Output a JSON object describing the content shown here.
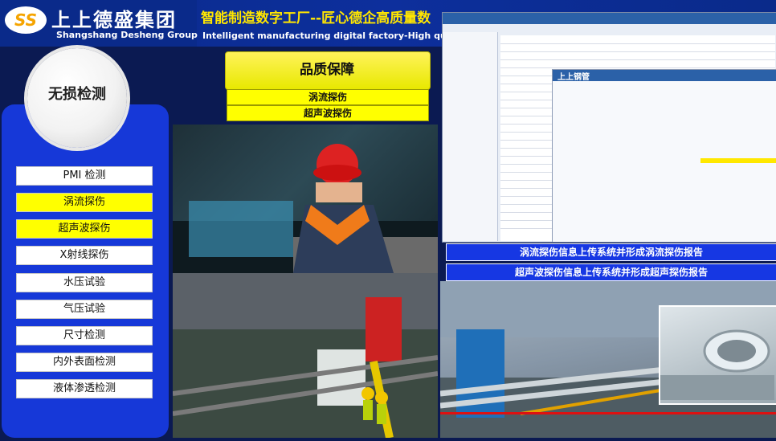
{
  "header": {
    "logo_mark": "SS",
    "company_cn": "上上德盛集团",
    "company_en": "Shangshang Desheng Group",
    "title_cn": "智能制造数字工厂--匠心德企高质量数",
    "title_en": "Intelligent manufacturing digital factory-High quality"
  },
  "left_panel": {
    "circle_label": "无损检测",
    "items": [
      {
        "label": "PMI 检测",
        "highlight": false
      },
      {
        "label": "涡流探伤",
        "highlight": true
      },
      {
        "label": "超声波探伤",
        "highlight": true
      },
      {
        "label": "X射线探伤",
        "highlight": false
      },
      {
        "label": "水压试验",
        "highlight": false
      },
      {
        "label": "气压试验",
        "highlight": false
      },
      {
        "label": "尺寸检测",
        "highlight": false
      },
      {
        "label": "内外表面检测",
        "highlight": false
      },
      {
        "label": "液体渗透检测",
        "highlight": false
      }
    ]
  },
  "center": {
    "banner_title": "品质保障",
    "sub1": "涡流探伤",
    "sub2": "超声波探伤"
  },
  "right": {
    "app_logo": "上上钢管",
    "bar1": "涡流探伤信息上传系统并形成涡流探伤报告",
    "bar2": "超声波探伤信息上传系统并形成超声探伤报告"
  },
  "colors": {
    "accent_yellow": "#ffff00",
    "accent_blue": "#1637e3",
    "bg_dark": "#0b1a52"
  }
}
